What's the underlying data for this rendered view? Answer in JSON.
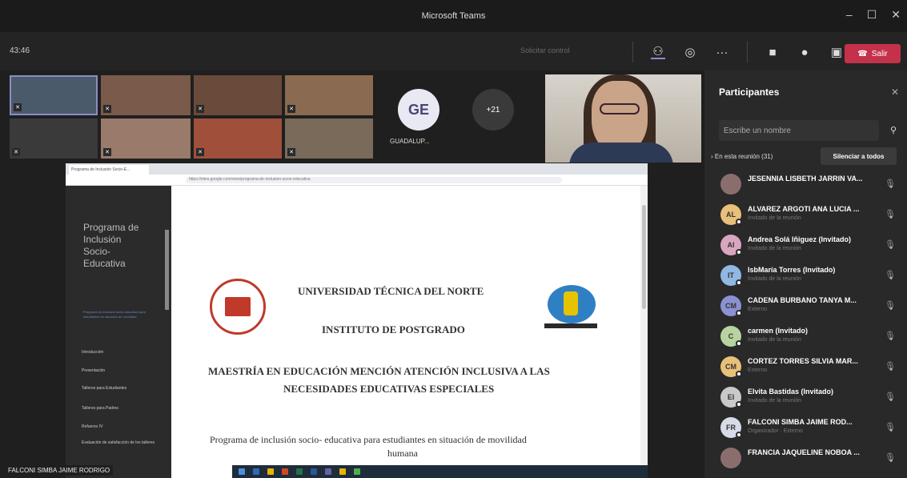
{
  "window": {
    "title": "Microsoft Teams",
    "controls": [
      "–",
      "☐",
      "✕"
    ]
  },
  "toolbar": {
    "timer": "43:46",
    "request_control": "Solicitar control",
    "icons": [
      "people-icon",
      "chat-icon",
      "more-icon",
      "camera-icon",
      "mic-icon",
      "share-icon"
    ],
    "leave_label": "Salir"
  },
  "stage": {
    "ge_initials": "GE",
    "ge_name": "GUADALUP...",
    "overflow": "+21",
    "presenter_name": "FALCONI SIMBA JAIME RODRIGO"
  },
  "browser": {
    "tab_title": "Programa de Inclusión Socio-E...",
    "url": "https://sites.google.com/view/programa-de-inclusion-socio-educativa",
    "sidebar_title": [
      "Programa de",
      "Inclusión",
      "Socio-",
      "Educativa"
    ],
    "sidebar_caption": "Programa de inclusión socio-educativa para estudiantes en situación de movilidad",
    "nav": [
      "Introducción",
      "Presentación",
      "Talleres para Estudiantes",
      "Talleres para Padres",
      "Refuerzo IV",
      "Evaluación de satisfacción de los talleres"
    ],
    "doc": {
      "university": "UNIVERSIDAD TÉCNICA DEL NORTE",
      "institute": "INSTITUTO DE POSTGRADO",
      "master_1": "MAESTRÍA EN EDUCACIÓN MENCIÓN ATENCIÓN INCLUSIVA A LAS",
      "master_2": "NECESIDADES EDUCATIVAS ESPECIALES",
      "program_1": "Programa de inclusión socio- educativa para estudiantes en situación de movilidad",
      "program_2": "humana"
    }
  },
  "participants": {
    "title": "Participantes",
    "search_placeholder": "Escribe un nombre",
    "in_meeting": "En esta reunión (31)",
    "mute_all": "Silenciar a todos",
    "list": [
      {
        "initials": "",
        "name": "JESENNIA LISBETH JARRIN VA...",
        "sub": "",
        "color": "#8a6e6e"
      },
      {
        "initials": "AL",
        "name": "ALVAREZ ARGOTI ANA LUCIA ...",
        "sub": "Invitado de la reunión",
        "color": "#e8c079"
      },
      {
        "initials": "AI",
        "name": "Andrea Solá Iñiguez (Invitado)",
        "sub": "Invitado de la reunión",
        "color": "#d9a6c2"
      },
      {
        "initials": "IT",
        "name": "IsbMaría Torres (Invitado)",
        "sub": "Invitado de la reunión",
        "color": "#8fb8e3"
      },
      {
        "initials": "CM",
        "name": "CADENA BURBANO TANYA M...",
        "sub": "Externo",
        "color": "#8a92d1"
      },
      {
        "initials": "C",
        "name": "carmen (Invitado)",
        "sub": "Invitado de la reunión",
        "color": "#b7d4a0"
      },
      {
        "initials": "CM",
        "name": "CORTEZ TORRES SILVIA MAR...",
        "sub": "Externo",
        "color": "#e8c079"
      },
      {
        "initials": "EI",
        "name": "Elvita Bastidas (Invitado)",
        "sub": "Invitado de la reunión",
        "color": "#c9c9c9"
      },
      {
        "initials": "FR",
        "name": "FALCONI SIMBA JAIME ROD...",
        "sub": "Organizador",
        "sub2": "Externo",
        "color": "#d7dbe8"
      },
      {
        "initials": "",
        "name": "FRANCIA JAQUELINE NOBOA ...",
        "sub": "",
        "color": "#8a6e6e"
      }
    ]
  }
}
